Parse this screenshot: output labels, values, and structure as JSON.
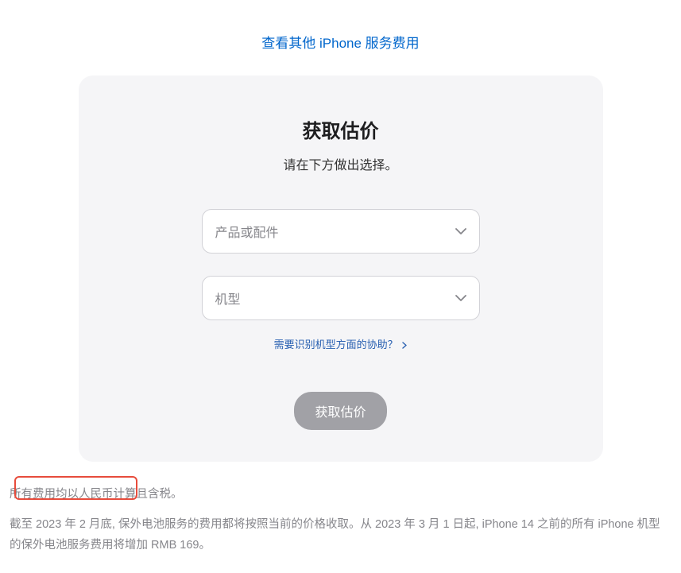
{
  "topLink": {
    "label": "查看其他 iPhone 服务费用"
  },
  "card": {
    "title": "获取估价",
    "subtitle": "请在下方做出选择。",
    "select1": {
      "placeholder": "产品或配件"
    },
    "select2": {
      "placeholder": "机型"
    },
    "helpLink": {
      "label": "需要识别机型方面的协助？"
    },
    "submitButton": {
      "label": "获取估价"
    }
  },
  "footer": {
    "line1": "所有费用均以人民币计算且含税。",
    "line2": "截至 2023 年 2 月底, 保外电池服务的费用都将按照当前的价格收取。从 2023 年 3 月 1 日起, iPhone 14 之前的所有 iPhone 机型的保外电池服务费用将增加 RMB 169。"
  }
}
